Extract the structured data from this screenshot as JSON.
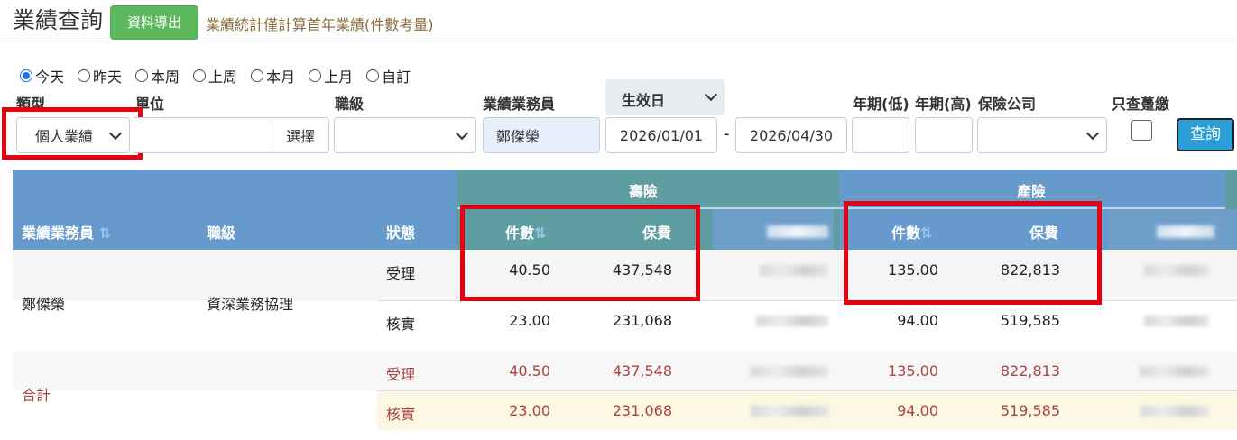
{
  "header": {
    "title": "業績查詢",
    "export_label": "資料導出",
    "note": "業績統計僅計算首年業績(件數考量)"
  },
  "date_ranges": [
    {
      "label": "今天",
      "checked": true
    },
    {
      "label": "昨天",
      "checked": false
    },
    {
      "label": "本周",
      "checked": false
    },
    {
      "label": "上周",
      "checked": false
    },
    {
      "label": "本月",
      "checked": false
    },
    {
      "label": "上月",
      "checked": false
    },
    {
      "label": "自訂",
      "checked": false
    }
  ],
  "filters": {
    "type_label": "類型",
    "type_value": "個人業績",
    "unit_label": "單位",
    "unit_value": "",
    "unit_select_label": "選擇",
    "rank_label": "職級",
    "rank_value": "",
    "agent_label": "業績業務員",
    "agent_value": "鄭傑榮",
    "date_field_label": "生效日",
    "date_from": "2026/01/01",
    "date_separator": "-",
    "date_to": "2026/04/30",
    "year_low_label": "年期(低)",
    "year_high_label": "年期(高)",
    "insurer_label": "保險公司",
    "only_paid_label": "只查躉繳",
    "query_label": "查詢"
  },
  "table": {
    "group_life": "壽險",
    "group_property": "產險",
    "col_agent": "業績業務員",
    "col_rank": "職級",
    "col_status": "狀態",
    "col_count": "件數",
    "col_premium": "保費",
    "agent_name": "鄭傑榮",
    "agent_rank": "資深業務協理",
    "rows": [
      {
        "status": "受理",
        "life_count": "40.50",
        "life_premium": "437,548",
        "prop_count": "135.00",
        "prop_premium": "822,813"
      },
      {
        "status": "核實",
        "life_count": "23.00",
        "life_premium": "231,068",
        "prop_count": "94.00",
        "prop_premium": "519,585"
      }
    ],
    "total_label": "合計",
    "totals": [
      {
        "status": "受理",
        "life_count": "40.50",
        "life_premium": "437,548",
        "prop_count": "135.00",
        "prop_premium": "822,813"
      },
      {
        "status": "核實",
        "life_count": "23.00",
        "life_premium": "231,068",
        "prop_count": "94.00",
        "prop_premium": "519,585"
      }
    ]
  },
  "colors": {
    "header_blue": "#6699cc",
    "header_teal": "#5f9ea0",
    "export_green": "#5cb85c",
    "highlight_red": "#e60012",
    "total_text": "#a94442"
  }
}
